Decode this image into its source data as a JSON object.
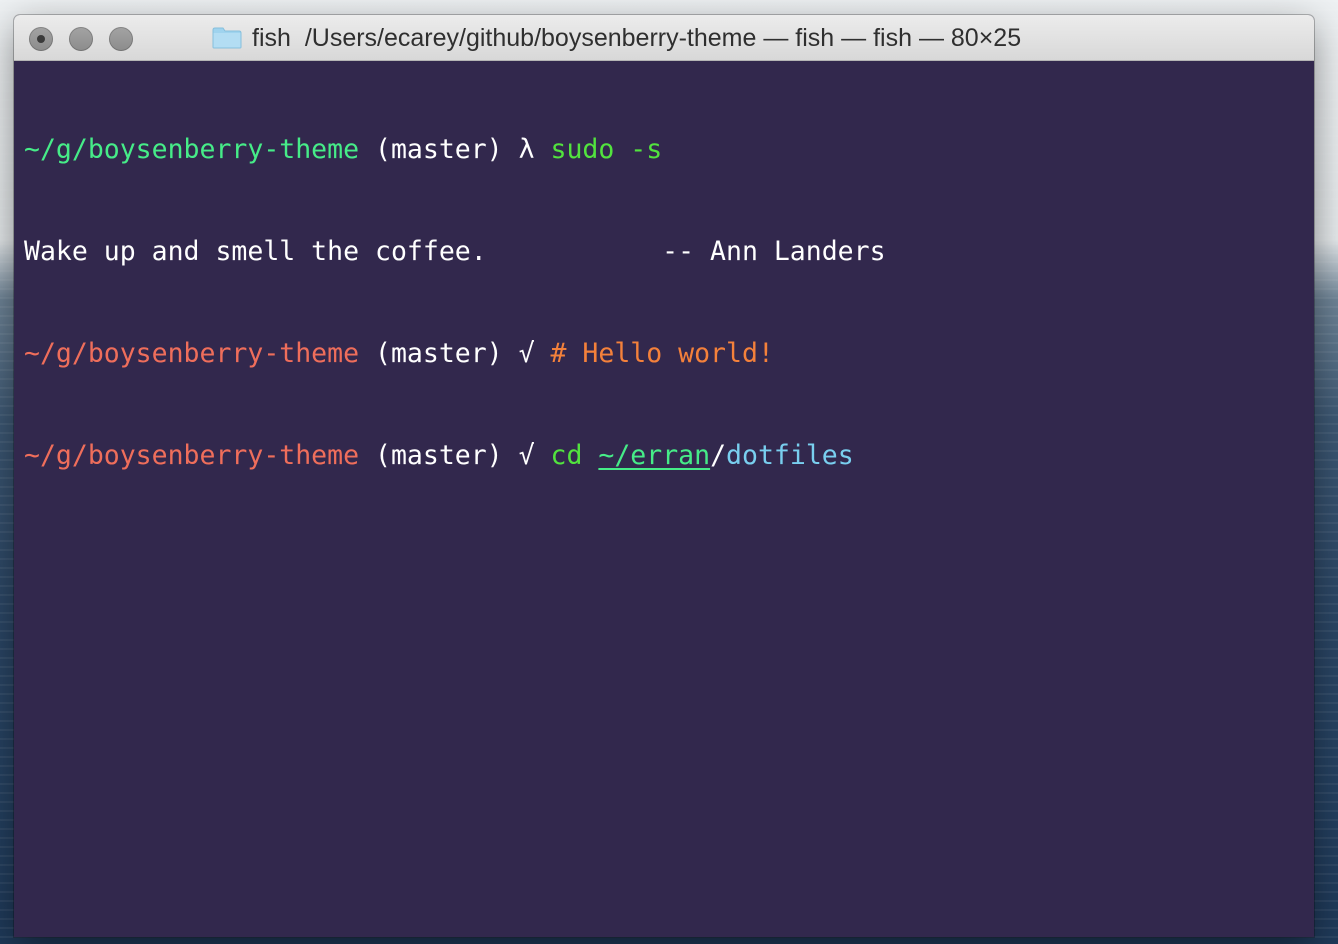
{
  "window": {
    "title_app": "fish",
    "title_path": "/Users/ecarey/github/boysenberry-theme — fish — fish — 80×25",
    "folder_icon": "folder-icon",
    "colors": {
      "background": "#32284d",
      "path_green": "#46ec88",
      "path_red": "#ef6e5b",
      "command": "#52e33e",
      "comment": "#f4813b",
      "dir": "#79cfef"
    }
  },
  "terminal": {
    "lines": [
      {
        "cwd": "~/g/boysenberry-theme",
        "branch": " (master) ",
        "prompt_symbol": "λ",
        "command": " sudo -s"
      },
      {
        "output": "Wake up and smell the coffee.           -- Ann Landers"
      },
      {
        "cwd": "~/g/boysenberry-theme",
        "branch": " (master) ",
        "prompt_symbol": "√",
        "comment": " # Hello world!"
      },
      {
        "cwd": "~/g/boysenberry-theme",
        "branch": " (master) ",
        "prompt_symbol": "√",
        "command": " cd ",
        "arg_underlined": "~/erran",
        "arg_sep": "/",
        "arg_rest": "dotfiles"
      }
    ]
  }
}
